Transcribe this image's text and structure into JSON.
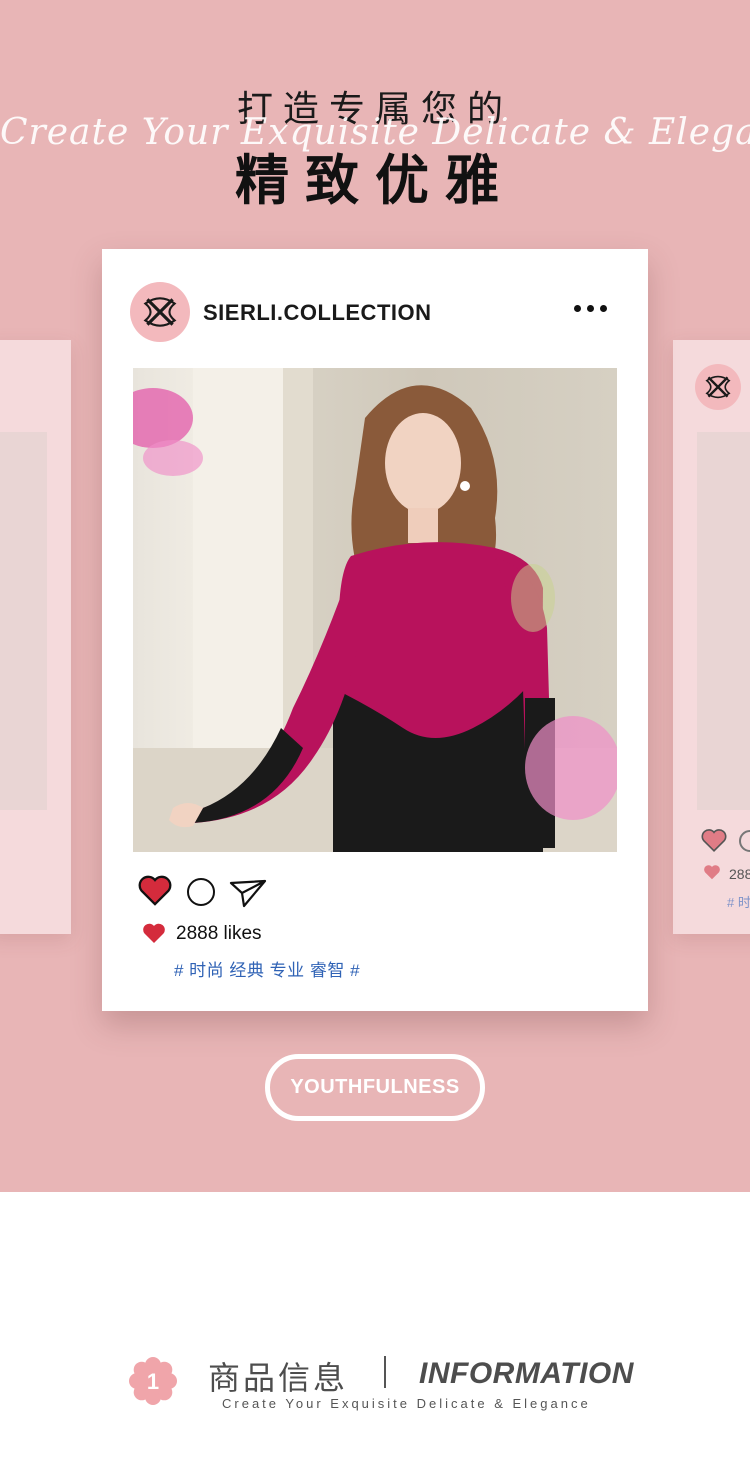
{
  "header": {
    "title_top": "打造专属您的",
    "script_line": "Create Your Exquisite Delicate & Elegance",
    "title_main": "精致优雅"
  },
  "post": {
    "username": "SIERLI.COLLECTION",
    "menu_icon": "more-dots-icon",
    "likes_text": "2888 likes",
    "tags": "# 时尚 经典 专业 睿智 #",
    "heart_color": "#d42b3c"
  },
  "side_card": {
    "likes_text": "288",
    "tags": "# 时"
  },
  "pill": {
    "label": "YOUTHFULNESS"
  },
  "info": {
    "badge_number": "1",
    "title_cn": "商品信息",
    "title_en": "INFORMATION",
    "subtitle": "Create Your Exquisite Delicate & Elegance"
  },
  "colors": {
    "background": "#e8b5b6",
    "card": "#ffffff",
    "accent_pink": "#f3b9bd",
    "tag_blue": "#2f62b5"
  }
}
